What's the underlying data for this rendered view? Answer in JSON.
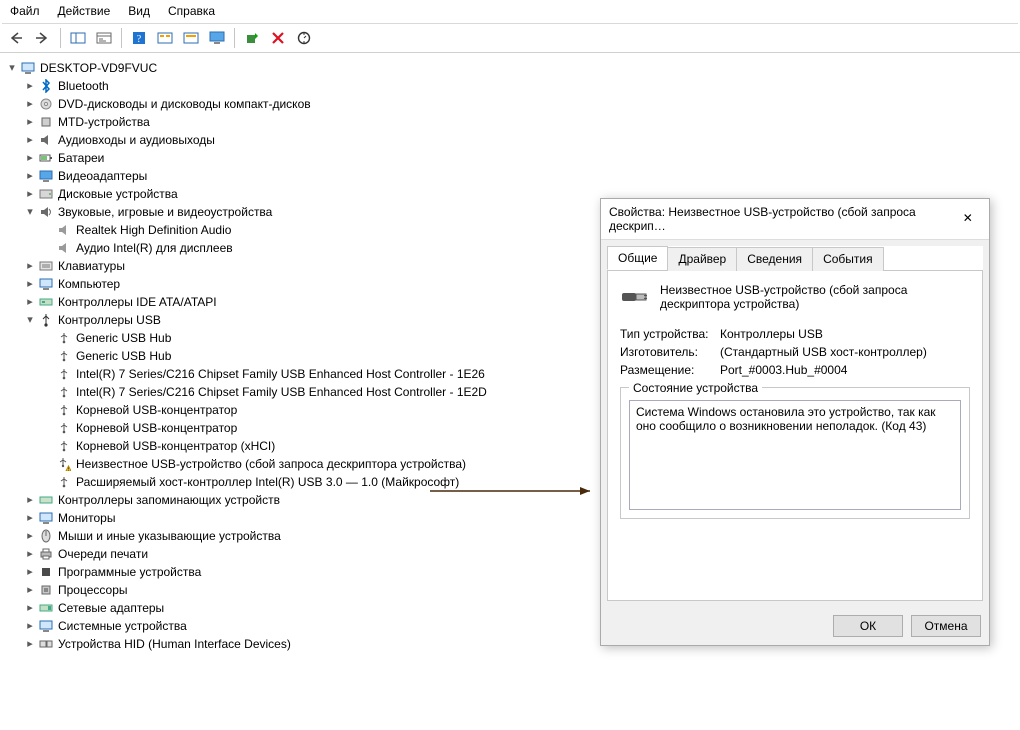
{
  "menu": {
    "file": "Файл",
    "action": "Действие",
    "view": "Вид",
    "help": "Справка"
  },
  "root": "DESKTOP-VD9FVUC",
  "cat": {
    "bluetooth": "Bluetooth",
    "dvd": "DVD-дисководы и дисководы компакт-дисков",
    "mtd": "MTD-устройства",
    "audio": "Аудиовходы и аудиовыходы",
    "battery": "Батареи",
    "video": "Видеоадаптеры",
    "disk": "Дисковые устройства",
    "sound": "Звуковые, игровые и видеоустройства",
    "keyboard": "Клавиатуры",
    "computer": "Компьютер",
    "ide": "Контроллеры IDE ATA/ATAPI",
    "usb": "Контроллеры USB",
    "storage": "Контроллеры запоминающих устройств",
    "monitor": "Мониторы",
    "mouse": "Мыши и иные указывающие устройства",
    "print": "Очереди печати",
    "software": "Программные устройства",
    "cpu": "Процессоры",
    "net": "Сетевые адаптеры",
    "system": "Системные устройства",
    "hid": "Устройства HID (Human Interface Devices)"
  },
  "soundChildren": {
    "a": "Realtek High Definition Audio",
    "b": "Аудио Intel(R) для дисплеев"
  },
  "usbChildren": {
    "a": "Generic USB Hub",
    "b": "Generic USB Hub",
    "c": "Intel(R) 7 Series/C216 Chipset Family USB Enhanced Host Controller - 1E26",
    "d": "Intel(R) 7 Series/C216 Chipset Family USB Enhanced Host Controller - 1E2D",
    "e": "Корневой USB-концентратор",
    "f": "Корневой USB-концентратор",
    "g": "Корневой USB-концентратор (xHCI)",
    "h": "Неизвестное USB-устройство (сбой запроса дескриптора устройства)",
    "i": "Расширяемый хост-контроллер Intel(R) USB 3.0 — 1.0 (Майкрософт)"
  },
  "dialog": {
    "title": "Свойства: Неизвестное USB-устройство (сбой запроса дескрип…",
    "tabs": {
      "general": "Общие",
      "driver": "Драйвер",
      "details": "Сведения",
      "events": "События"
    },
    "devname": "Неизвестное USB-устройство (сбой запроса дескриптора устройства)",
    "type_k": "Тип устройства:",
    "type_v": "Контроллеры USB",
    "mfg_k": "Изготовитель:",
    "mfg_v": "(Стандартный USB хост-контроллер)",
    "loc_k": "Размещение:",
    "loc_v": "Port_#0003.Hub_#0004",
    "status_legend": "Состояние устройства",
    "status_text": "Система Windows остановила это устройство, так как оно сообщило о возникновении неполадок. (Код 43)",
    "ok": "ОК",
    "cancel": "Отмена"
  }
}
